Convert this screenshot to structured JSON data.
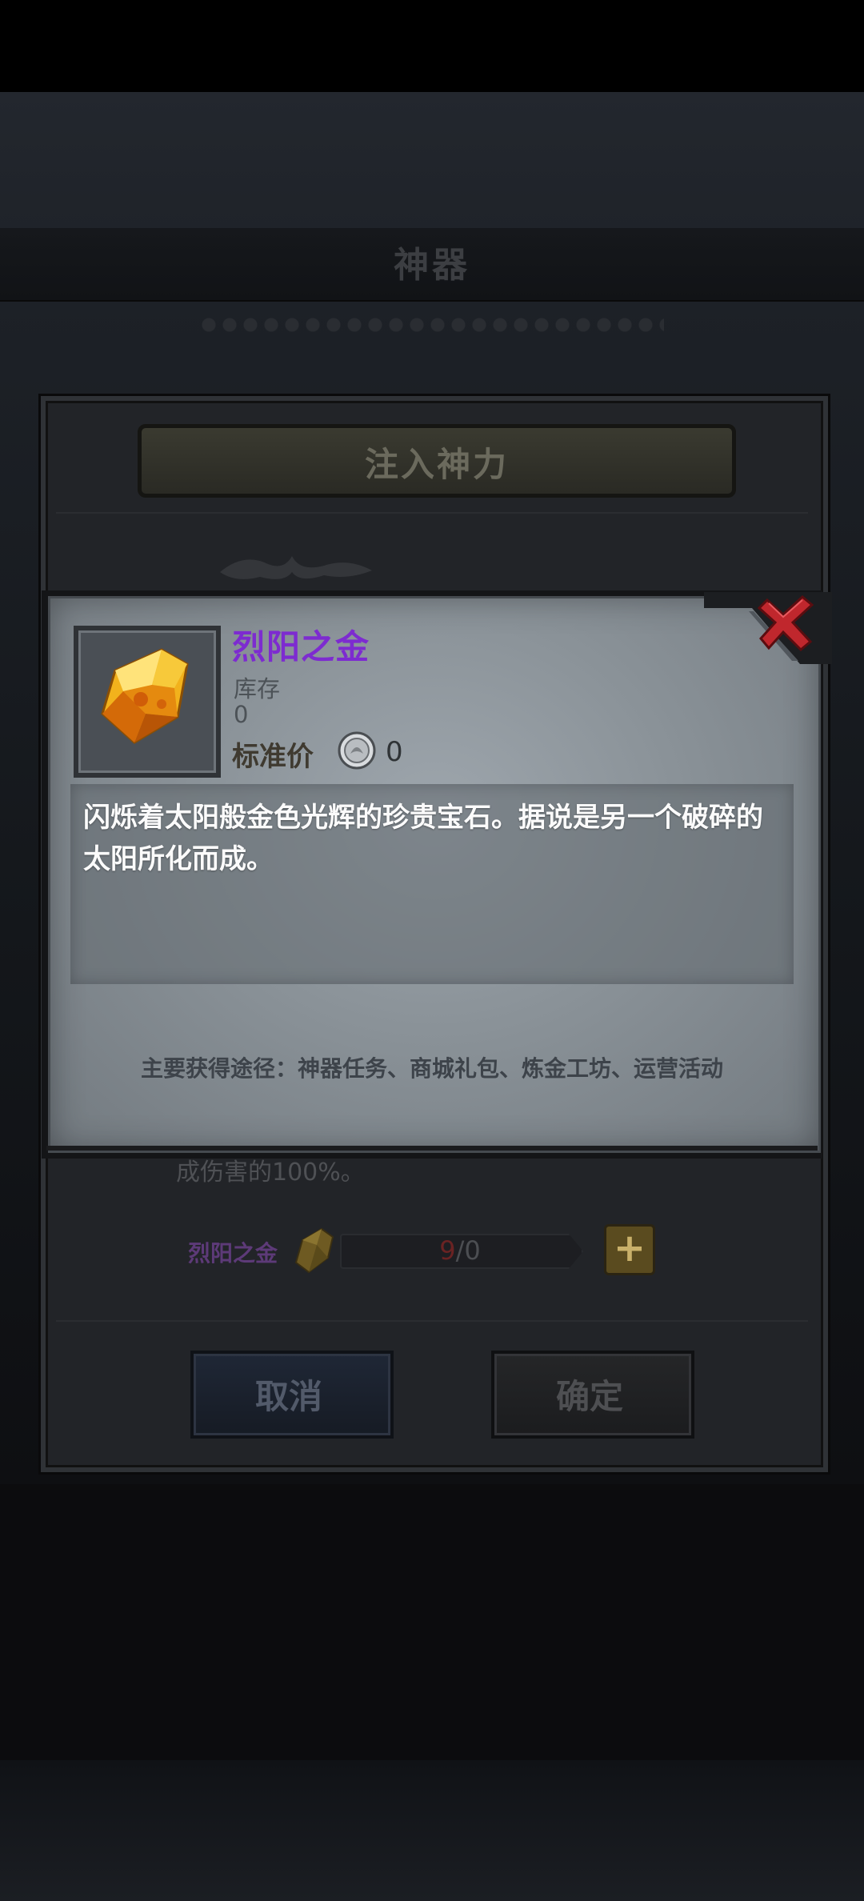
{
  "background": {
    "header_title": "神器"
  },
  "infuse_dialog": {
    "title": "注入神力",
    "percent_text": "成伤害的100%。",
    "material_label": "烈阳之金",
    "progress": {
      "current": "9",
      "separator": "/",
      "required": "0"
    },
    "plus_label": "+",
    "cancel_label": "取消",
    "confirm_label": "确定"
  },
  "item_popup": {
    "name": "烈阳之金",
    "stock_label": "库存",
    "stock_value": "0",
    "price_label": "标准价",
    "price_value": "0",
    "description": "闪烁着太阳般金色光辉的珍贵宝石。据说是另一个破碎的太阳所化而成。",
    "source": "主要获得途径：神器任务、商城礼包、炼金工坊、运营活动"
  },
  "colors": {
    "item_name": "#7d2bd0",
    "close_x": "#c0272d",
    "gem_gold": "#f2b21c"
  },
  "icons": [
    "close-icon",
    "gem-icon",
    "silver-coin-icon",
    "plus-icon"
  ]
}
